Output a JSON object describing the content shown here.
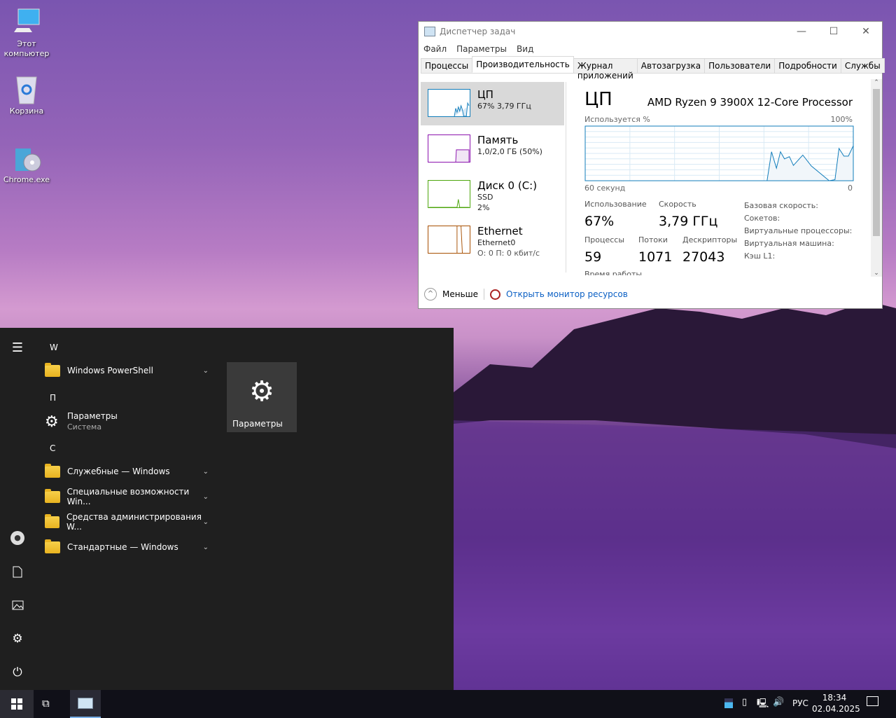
{
  "desktop": {
    "icons": [
      {
        "label": "Этот компьютер"
      },
      {
        "label": "Корзина"
      },
      {
        "label": "Chrome.exe"
      }
    ]
  },
  "taskmgr": {
    "title": "Диспетчер задач",
    "menu": [
      "Файл",
      "Параметры",
      "Вид"
    ],
    "tabs": [
      "Процессы",
      "Производительность",
      "Журнал приложений",
      "Автозагрузка",
      "Пользователи",
      "Подробности",
      "Службы"
    ],
    "active_tab": 1,
    "sidebar": [
      {
        "name": "ЦП",
        "line1": "67% 3,79 ГГц",
        "line2": "",
        "color": "#117dbb"
      },
      {
        "name": "Память",
        "line1": "1,0/2,0 ГБ (50%)",
        "line2": "",
        "color": "#8b12ae"
      },
      {
        "name": "Диск 0 (C:)",
        "line1": "SSD",
        "line2": "2%",
        "color": "#4da60c"
      },
      {
        "name": "Ethernet",
        "line1": "Ethernet0",
        "line2": "О: 0 П: 0 кбит/с",
        "color": "#a74f01"
      }
    ],
    "cpu": {
      "heading": "ЦП",
      "model": "AMD Ryzen 9 3900X 12-Core Processor",
      "stats": {
        "usage_label": "Использование",
        "usage": "67%",
        "speed_label": "Скорость",
        "speed": "3,79 ГГц",
        "proc_label": "Процессы",
        "proc": "59",
        "threads_label": "Потоки",
        "threads": "1071",
        "handles_label": "Дескрипторы",
        "handles": "27043",
        "uptime_label": "Время работы"
      },
      "info": [
        "Базовая скорость:",
        "Сокетов:",
        "Виртуальные процессоры:",
        "Виртуальная машина:",
        "Кэш L1:"
      ]
    },
    "footer": {
      "less": "Меньше",
      "resmon": "Открыть монитор ресурсов"
    }
  },
  "chart_data": {
    "type": "area",
    "title": "Используется %",
    "ylabel": "Используется %",
    "ymax_label": "100%",
    "xlabel_left": "60 секунд",
    "xlabel_right": "0",
    "xlim": [
      0,
      60
    ],
    "ylim": [
      0,
      100
    ],
    "grid": true,
    "color": "#117dbb",
    "x": [
      0,
      40.7,
      41.7,
      42.8,
      43.7,
      44.6,
      45.7,
      46.6,
      48.7,
      50.6,
      54.6,
      55.9,
      56.8,
      57.9,
      58.9,
      60
    ],
    "values": [
      0,
      0,
      53,
      23,
      53,
      40,
      44,
      28,
      47,
      27,
      0,
      2,
      59,
      45,
      45,
      64
    ]
  },
  "start": {
    "sections": [
      {
        "letter": "W",
        "apps": [
          {
            "label": "Windows PowerShell",
            "type": "folder"
          }
        ]
      },
      {
        "letter": "П",
        "apps": [
          {
            "label": "Параметры",
            "sub": "Система",
            "type": "gear"
          }
        ]
      },
      {
        "letter": "С",
        "apps": [
          {
            "label": "Служебные — Windows",
            "type": "folder"
          },
          {
            "label": "Специальные возможности Win...",
            "type": "folder"
          },
          {
            "label": "Средства администрирования W...",
            "type": "folder"
          },
          {
            "label": "Стандартные — Windows",
            "type": "folder"
          }
        ]
      }
    ],
    "tile": {
      "label": "Параметры"
    }
  },
  "taskbar": {
    "lang": "РУС",
    "time": "18:34",
    "date": "02.04.2025"
  }
}
